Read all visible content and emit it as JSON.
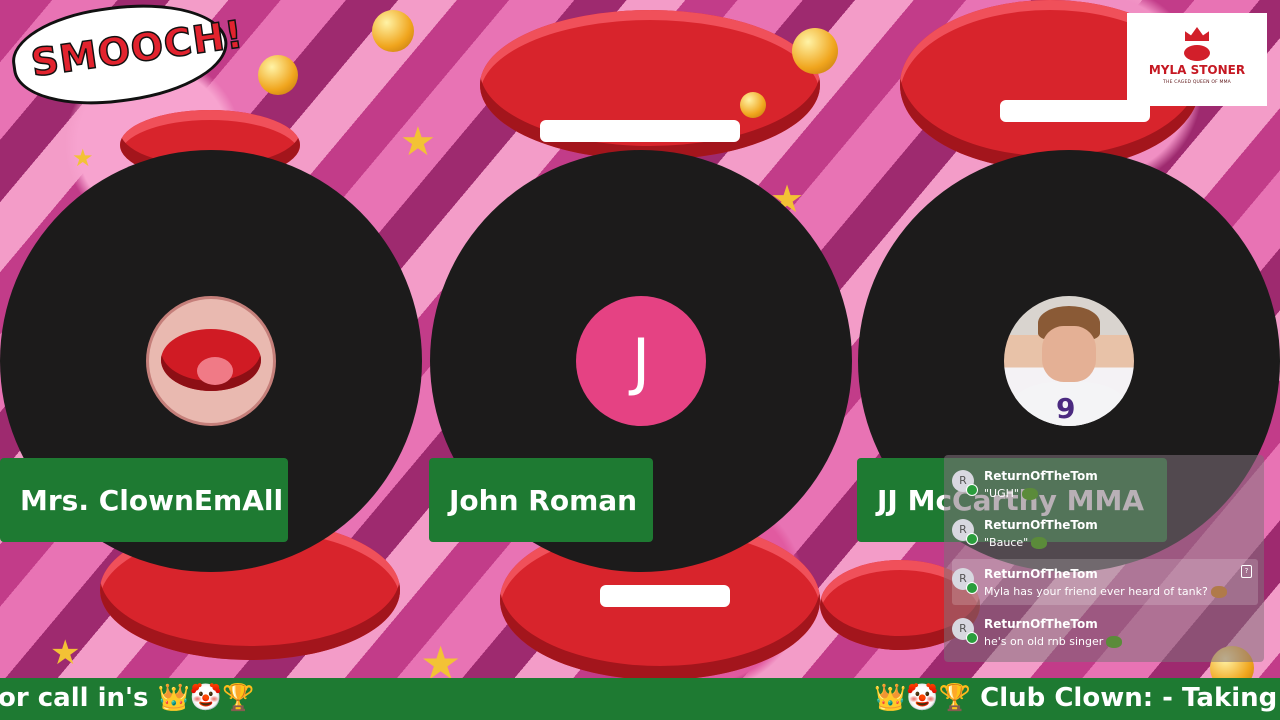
{
  "background": {
    "bubble_text": "SMOOCH!",
    "colors": {
      "pink": "#e873b4",
      "lip_red": "#d8242c",
      "star": "#f3c235"
    }
  },
  "logo": {
    "title": "MYLA STONER",
    "subtitle": "THE CAGED QUEEN OF MMA"
  },
  "participants": [
    {
      "name": "Mrs. ClownEmAll",
      "avatar": "lips-icon"
    },
    {
      "name": "John Roman",
      "avatar_initial": "J",
      "avatar_color": "#e54283"
    },
    {
      "name": "JJ McCarthy MMA",
      "avatar": "football-player-photo"
    }
  ],
  "chat": {
    "messages": [
      {
        "avatar": "R",
        "user": "ReturnOfTheTom",
        "text": "\"UGH\""
      },
      {
        "avatar": "R",
        "user": "ReturnOfTheTom",
        "text": "\"Bauce\""
      },
      {
        "avatar": "R",
        "user": "ReturnOfTheTom",
        "text": "Myla has your friend ever heard of tank?"
      },
      {
        "avatar": "R",
        "user": "ReturnOfTheTom",
        "text": "he's on old rnb singer"
      }
    ]
  },
  "ticker": {
    "left_text": "or call in's 👑🤡🏆",
    "right_text": "👑🤡🏆 Club Clown: - Taking so"
  }
}
